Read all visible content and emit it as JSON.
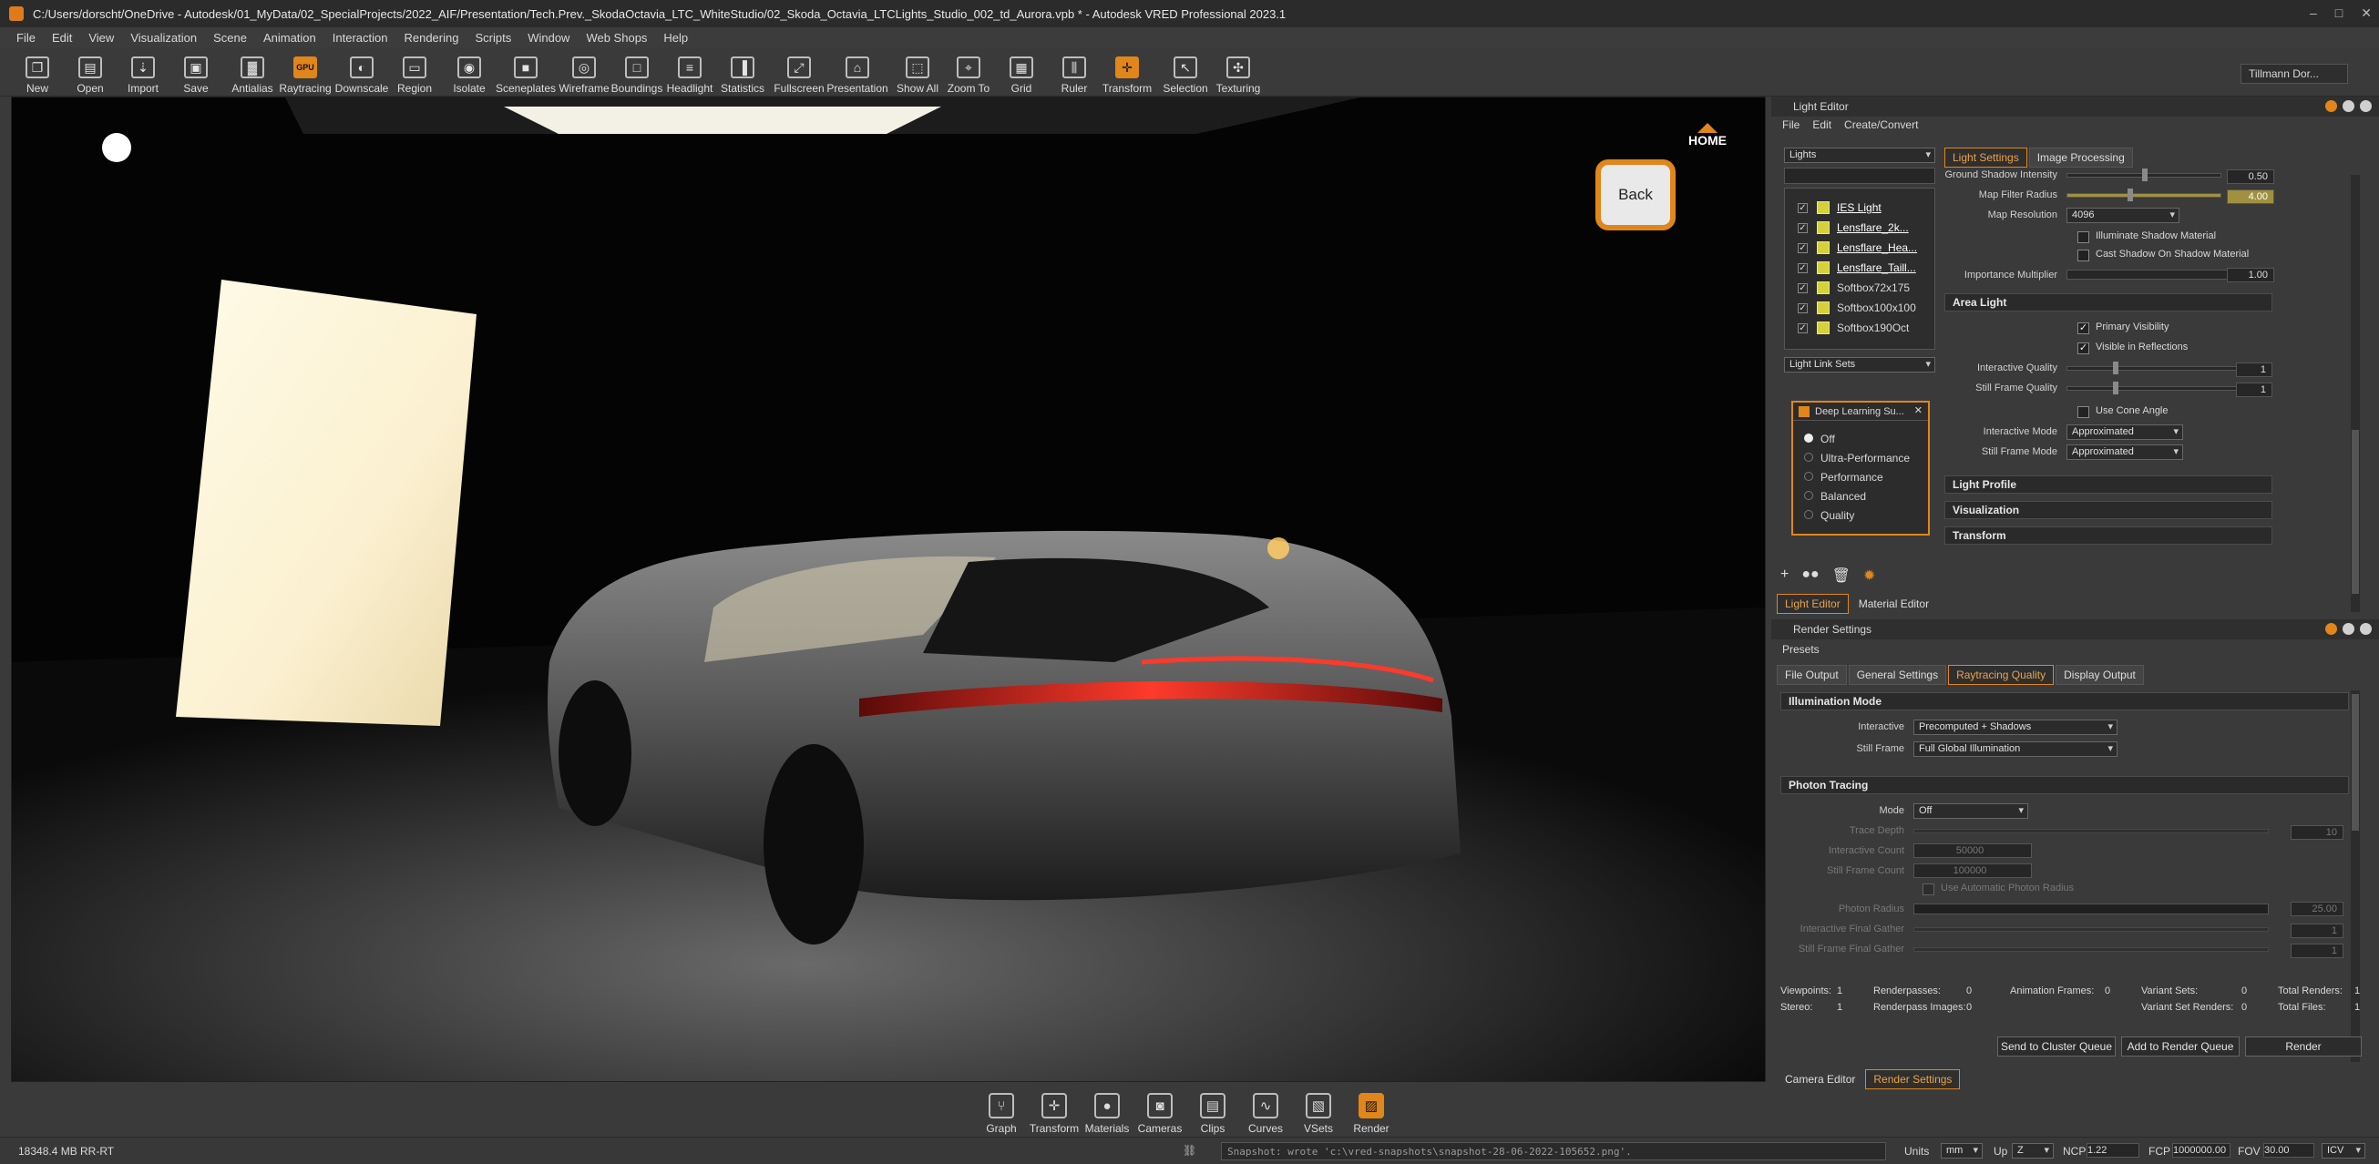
{
  "window": {
    "title": "C:/Users/dorscht/OneDrive - Autodesk/01_MyData/02_SpecialProjects/2022_AIF/Presentation/Tech.Prev._SkodaOctavia_LTC_WhiteStudio/02_Skoda_Octavia_LTCLights_Studio_002_td_Aurora.vpb * - Autodesk VRED Professional 2023.1",
    "controls": [
      "–",
      "□",
      "✕"
    ]
  },
  "menu": [
    "File",
    "Edit",
    "View",
    "Visualization",
    "Scene",
    "Animation",
    "Interaction",
    "Rendering",
    "Scripts",
    "Window",
    "Web Shops",
    "Help"
  ],
  "toolbar": [
    {
      "label": "New",
      "icon": "new-file-icon",
      "glyph": "❐"
    },
    {
      "label": "Open",
      "icon": "open-folder-icon",
      "glyph": "▤"
    },
    {
      "label": "Import",
      "icon": "import-icon",
      "glyph": "⇣"
    },
    {
      "label": "Save",
      "icon": "save-icon",
      "glyph": "▣"
    },
    {
      "label": "Antialias",
      "icon": "antialias-icon",
      "glyph": "▓"
    },
    {
      "label": "Raytracing",
      "icon": "raytracing-icon",
      "glyph": "GPU"
    },
    {
      "label": "Downscale",
      "icon": "downscale-icon",
      "glyph": "◐"
    },
    {
      "label": "Region",
      "icon": "region-icon",
      "glyph": "▭"
    },
    {
      "label": "Isolate",
      "icon": "isolate-icon",
      "glyph": "◉"
    },
    {
      "label": "Sceneplates",
      "icon": "sceneplates-icon",
      "glyph": "■"
    },
    {
      "label": "Wireframe",
      "icon": "wireframe-icon",
      "glyph": "◎"
    },
    {
      "label": "Boundings",
      "icon": "boundings-icon",
      "glyph": "□"
    },
    {
      "label": "Headlight",
      "icon": "headlight-icon",
      "glyph": "≡"
    },
    {
      "label": "Statistics",
      "icon": "statistics-icon",
      "glyph": "▐"
    },
    {
      "label": "Fullscreen",
      "icon": "fullscreen-icon",
      "glyph": "⤢"
    },
    {
      "label": "Presentation",
      "icon": "presentation-icon",
      "glyph": "⌂"
    },
    {
      "label": "Show All",
      "icon": "show-all-icon",
      "glyph": "⬚"
    },
    {
      "label": "Zoom To",
      "icon": "zoom-to-icon",
      "glyph": "⌖"
    },
    {
      "label": "Grid",
      "icon": "grid-icon",
      "glyph": "▦"
    },
    {
      "label": "Ruler",
      "icon": "ruler-icon",
      "glyph": "⫼"
    },
    {
      "label": "Transform",
      "icon": "transform-icon",
      "glyph": "✛"
    },
    {
      "label": "Selection",
      "icon": "selection-icon",
      "glyph": "↖"
    },
    {
      "label": "Texturing",
      "icon": "texturing-icon",
      "glyph": "✣"
    }
  ],
  "user": "Tillmann Dor...",
  "viewport": {
    "home_label": "HOME",
    "back_label": "Back"
  },
  "light_editor": {
    "title": "Light Editor",
    "menu": [
      "File",
      "Edit",
      "Create/Convert"
    ],
    "lights_filter": "Lights",
    "lights": [
      {
        "name": "IES Light",
        "selected": true
      },
      {
        "name": "Lensflare_2k...",
        "selected": true
      },
      {
        "name": "Lensflare_Hea...",
        "selected": true
      },
      {
        "name": "Lensflare_Taill...",
        "selected": true
      },
      {
        "name": "Softbox72x175",
        "selected": false
      },
      {
        "name": "Softbox100x100",
        "selected": false
      },
      {
        "name": "Softbox190Oct",
        "selected": false
      }
    ],
    "link_sets": "Light Link Sets",
    "tabs": [
      "Light Settings",
      "Image Processing"
    ],
    "props": {
      "ground_shadow_intensity": {
        "label": "Ground Shadow Intensity",
        "value": "0.50",
        "level": 0.5
      },
      "map_filter_radius": {
        "label": "Map Filter Radius",
        "value": "4.00",
        "level": 0.4
      },
      "map_resolution": {
        "label": "Map Resolution",
        "value": "4096"
      },
      "illuminate_shadow_material": "Illuminate Shadow Material",
      "cast_shadow_on_shadow_material": "Cast Shadow On Shadow Material",
      "importance_multiplier": {
        "label": "Importance Multiplier",
        "value": "1.00"
      }
    },
    "area_light": {
      "title": "Area Light",
      "primary_visibility": "Primary Visibility",
      "visible_in_reflections": "Visible in Reflections",
      "interactive_quality": {
        "label": "Interactive Quality",
        "value": "1"
      },
      "still_frame_quality": {
        "label": "Still Frame Quality",
        "value": "1"
      },
      "use_cone_angle": "Use Cone Angle",
      "interactive_mode": {
        "label": "Interactive Mode",
        "value": "Approximated"
      },
      "still_frame_mode": {
        "label": "Still Frame Mode",
        "value": "Approximated"
      }
    },
    "collapsed_sections": [
      "Light Profile",
      "Visualization",
      "Transform"
    ],
    "bottom_tabs": [
      "Light Editor",
      "Material Editor"
    ]
  },
  "dlss": {
    "title": "Deep Learning Su...",
    "options": [
      "Off",
      "Ultra-Performance",
      "Performance",
      "Balanced",
      "Quality"
    ],
    "selected": "Off"
  },
  "render_settings": {
    "title": "Render Settings",
    "presets": "Presets",
    "tabs": [
      "File Output",
      "General Settings",
      "Raytracing Quality",
      "Display Output"
    ],
    "illumination_mode": {
      "title": "Illumination Mode",
      "interactive": {
        "label": "Interactive",
        "value": "Precomputed + Shadows"
      },
      "still_frame": {
        "label": "Still Frame",
        "value": "Full Global Illumination"
      }
    },
    "photon_tracing": {
      "title": "Photon Tracing",
      "mode": {
        "label": "Mode",
        "value": "Off"
      },
      "trace_depth": {
        "label": "Trace Depth",
        "value": "10"
      },
      "interactive_count": {
        "label": "Interactive Count",
        "value": "50000"
      },
      "still_frame_count": {
        "label": "Still Frame Count",
        "value": "100000"
      },
      "use_automatic_photon_radius": "Use Automatic Photon Radius",
      "photon_radius": {
        "label": "Photon Radius",
        "value": "25.00"
      },
      "interactive_final_gather": {
        "label": "Interactive Final Gather",
        "value": "1"
      },
      "still_frame_final_gather": {
        "label": "Still Frame Final Gather",
        "value": "1"
      }
    },
    "stats": {
      "viewpoints": {
        "label": "Viewpoints:",
        "value": "1"
      },
      "stereo": {
        "label": "Stereo:",
        "value": "1"
      },
      "renderpasses": {
        "label": "Renderpasses:",
        "value": "0"
      },
      "renderpass_images": {
        "label": "Renderpass Images:",
        "value": "0"
      },
      "animation_frames": {
        "label": "Animation Frames:",
        "value": "0"
      },
      "variant_sets": {
        "label": "Variant Sets:",
        "value": "0"
      },
      "variant_set_renders": {
        "label": "Variant Set Renders:",
        "value": "0"
      },
      "total_renders": {
        "label": "Total Renders:",
        "value": "1"
      },
      "total_files": {
        "label": "Total Files:",
        "value": "1"
      }
    },
    "buttons": [
      "Send to Cluster Queue",
      "Add to Render Queue",
      "Render"
    ],
    "bottom_tabs": [
      "Camera Editor",
      "Render Settings"
    ]
  },
  "dock": [
    {
      "label": "Graph",
      "icon": "graph-icon",
      "glyph": "⑂"
    },
    {
      "label": "Transform",
      "icon": "transform-icon",
      "glyph": "✛"
    },
    {
      "label": "Materials",
      "icon": "materials-icon",
      "glyph": "●"
    },
    {
      "label": "Cameras",
      "icon": "cameras-icon",
      "glyph": "◙"
    },
    {
      "label": "Clips",
      "icon": "clips-icon",
      "glyph": "▤"
    },
    {
      "label": "Curves",
      "icon": "curves-icon",
      "glyph": "∿"
    },
    {
      "label": "VSets",
      "icon": "vsets-icon",
      "glyph": "▧"
    },
    {
      "label": "Render",
      "icon": "render-icon",
      "glyph": "▨"
    }
  ],
  "status": {
    "memory": "18348.4 MB",
    "mode": "RR-RT",
    "message": "Snapshot: wrote 'c:\\vred-snapshots\\snapshot-28-06-2022-105652.png'.",
    "units_label": "Units",
    "units": "mm",
    "up_label": "Up",
    "up": "Z",
    "ncp_label": "NCP",
    "ncp": "1.22",
    "fcp_label": "FCP",
    "fcp": "1000000.00",
    "fov_label": "FOV",
    "fov": "30.00",
    "icv": "ICV"
  },
  "colors": {
    "accent": "#e0861a",
    "background": "#3a3a3a",
    "viewport": "#050505"
  }
}
